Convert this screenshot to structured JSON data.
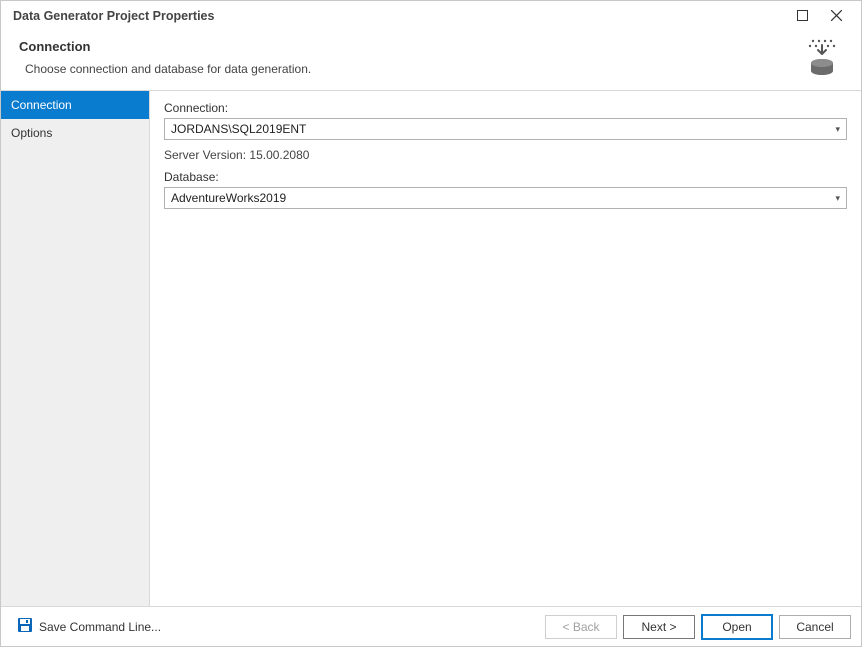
{
  "window": {
    "title": "Data Generator Project Properties"
  },
  "header": {
    "title": "Connection",
    "subtitle": "Choose connection and database for data generation.",
    "icon": "data-generator-icon"
  },
  "sidebar": {
    "items": [
      {
        "label": "Connection",
        "active": true
      },
      {
        "label": "Options",
        "active": false
      }
    ]
  },
  "main": {
    "connection_label": "Connection:",
    "connection_value": "JORDANS\\SQL2019ENT",
    "server_version_label": "Server Version:",
    "server_version_value": "15.00.2080",
    "database_label": "Database:",
    "database_value": "AdventureWorks2019"
  },
  "footer": {
    "save_cmd_label": "Save Command Line...",
    "back_label": "< Back",
    "next_label": "Next >",
    "open_label": "Open",
    "cancel_label": "Cancel"
  }
}
